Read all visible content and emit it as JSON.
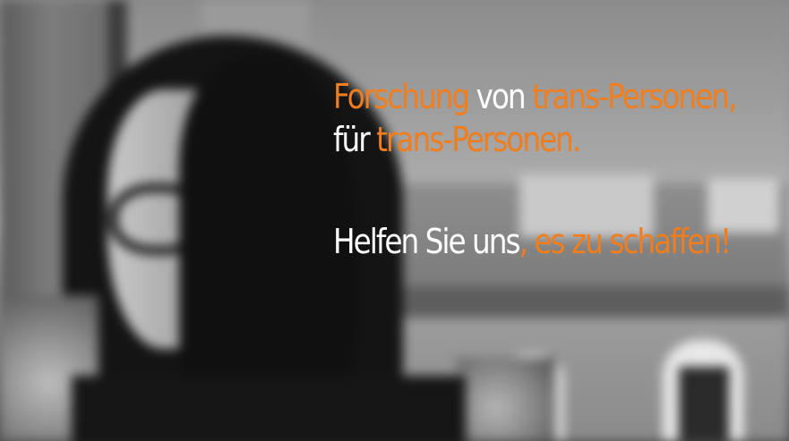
{
  "headline": {
    "line1": {
      "part1": "Forschung",
      "part2": " von ",
      "part3": "trans-Personen,"
    },
    "line2": {
      "part1": "für ",
      "part2": "trans-Personen."
    },
    "line3": {
      "part1": "Helfen Sie uns",
      "part2": ", es zu schaffen!"
    }
  },
  "colors": {
    "accent": "#f07d1e",
    "text": "#ffffff"
  },
  "photo": {
    "description_icon": "blurred-portrait-photo"
  }
}
